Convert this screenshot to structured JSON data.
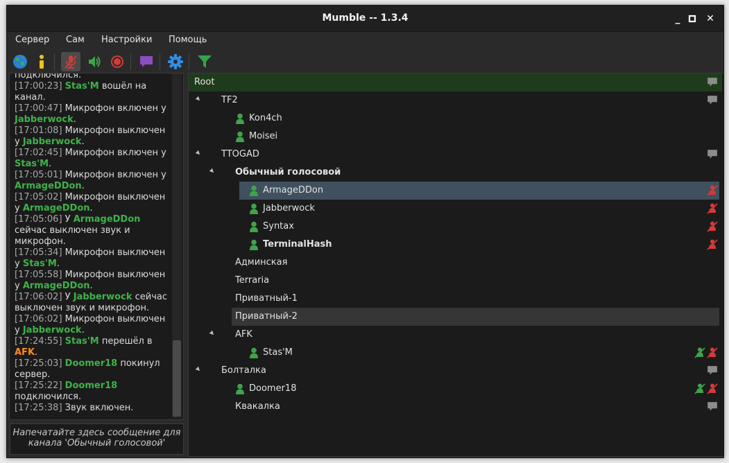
{
  "window": {
    "title": "Mumble -- 1.3.4"
  },
  "window_controls": {
    "minimize": "_",
    "maximize": "□",
    "close": "✕"
  },
  "menu": [
    "Сервер",
    "Сам",
    "Настройки",
    "Помощь"
  ],
  "toolbar": [
    {
      "id": "connect",
      "icon": "globe-icon"
    },
    {
      "id": "info",
      "icon": "info-icon"
    },
    {
      "id": "mute_self",
      "icon": "muted-mic-icon",
      "active": true
    },
    {
      "id": "deafen_self",
      "icon": "speaker-icon"
    },
    {
      "id": "record",
      "icon": "record-icon"
    },
    {
      "id": "text_message",
      "icon": "chat-bubble-icon"
    },
    {
      "id": "configure",
      "icon": "gear-icon"
    },
    {
      "id": "filter",
      "icon": "filter-icon"
    }
  ],
  "log": [
    [
      {
        "t": "text",
        "v": "подключился."
      }
    ],
    [
      {
        "t": "ts",
        "v": "[17:00:23]"
      },
      {
        "t": "text",
        "v": " "
      },
      {
        "t": "user",
        "v": "Stas'M"
      },
      {
        "t": "text",
        "v": " вошёл на канал."
      }
    ],
    [
      {
        "t": "ts",
        "v": "[17:00:47]"
      },
      {
        "t": "text",
        "v": " Микрофон включен у "
      },
      {
        "t": "user",
        "v": "Jabberwock"
      },
      {
        "t": "text",
        "v": "."
      }
    ],
    [
      {
        "t": "ts",
        "v": "[17:01:08]"
      },
      {
        "t": "text",
        "v": " Микрофон выключен у "
      },
      {
        "t": "user",
        "v": "Jabberwock"
      },
      {
        "t": "text",
        "v": "."
      }
    ],
    [
      {
        "t": "ts",
        "v": "[17:02:45]"
      },
      {
        "t": "text",
        "v": " Микрофон включен у "
      },
      {
        "t": "user",
        "v": "Stas'M"
      },
      {
        "t": "text",
        "v": "."
      }
    ],
    [
      {
        "t": "ts",
        "v": "[17:05:01]"
      },
      {
        "t": "text",
        "v": " Микрофон включен у "
      },
      {
        "t": "user",
        "v": "ArmageDDon"
      },
      {
        "t": "text",
        "v": "."
      }
    ],
    [
      {
        "t": "ts",
        "v": "[17:05:02]"
      },
      {
        "t": "text",
        "v": " Микрофон выключен у "
      },
      {
        "t": "user",
        "v": "ArmageDDon"
      },
      {
        "t": "text",
        "v": "."
      }
    ],
    [
      {
        "t": "ts",
        "v": "[17:05:06]"
      },
      {
        "t": "text",
        "v": " У "
      },
      {
        "t": "user",
        "v": "ArmageDDon"
      },
      {
        "t": "text",
        "v": " сейчас выключен звук и микрофон."
      }
    ],
    [
      {
        "t": "ts",
        "v": "[17:05:34]"
      },
      {
        "t": "text",
        "v": " Микрофон выключен у "
      },
      {
        "t": "user",
        "v": "Stas'M"
      },
      {
        "t": "text",
        "v": "."
      }
    ],
    [
      {
        "t": "ts",
        "v": "[17:05:58]"
      },
      {
        "t": "text",
        "v": " Микрофон выключен у "
      },
      {
        "t": "user",
        "v": "ArmageDDon"
      },
      {
        "t": "text",
        "v": "."
      }
    ],
    [
      {
        "t": "ts",
        "v": "[17:06:02]"
      },
      {
        "t": "text",
        "v": " У "
      },
      {
        "t": "user",
        "v": "Jabberwock"
      },
      {
        "t": "text",
        "v": " сейчас выключен звук и микрофон."
      }
    ],
    [
      {
        "t": "ts",
        "v": "[17:06:02]"
      },
      {
        "t": "text",
        "v": " Микрофон выключен у "
      },
      {
        "t": "user",
        "v": "Jabberwock"
      },
      {
        "t": "text",
        "v": "."
      }
    ],
    [
      {
        "t": "ts",
        "v": "[17:24:55]"
      },
      {
        "t": "text",
        "v": " "
      },
      {
        "t": "user",
        "v": "Stas'M"
      },
      {
        "t": "text",
        "v": " перешёл в "
      },
      {
        "t": "channel",
        "v": "AFK"
      },
      {
        "t": "text",
        "v": "."
      }
    ],
    [
      {
        "t": "ts",
        "v": "[17:25:03]"
      },
      {
        "t": "text",
        "v": " "
      },
      {
        "t": "user",
        "v": "Doomer18"
      },
      {
        "t": "text",
        "v": " покинул сервер."
      }
    ],
    [
      {
        "t": "ts",
        "v": "[17:25:22]"
      },
      {
        "t": "text",
        "v": " "
      },
      {
        "t": "user",
        "v": "Doomer18"
      },
      {
        "t": "text",
        "v": " подключился."
      }
    ],
    [
      {
        "t": "ts",
        "v": "[17:25:38]"
      },
      {
        "t": "text",
        "v": " Звук включен."
      }
    ]
  ],
  "chat_input": {
    "placeholder": "Напечатайте здесь сообщение для канала 'Обычный голосовой'"
  },
  "tree": [
    {
      "label": "Root",
      "type": "channel",
      "level": 0,
      "expander": false,
      "comment": true,
      "highlight": "root"
    },
    {
      "label": "TF2",
      "type": "channel",
      "level": 1,
      "expander": true,
      "comment": true
    },
    {
      "label": "Kon4ch",
      "type": "user",
      "level": 2
    },
    {
      "label": "Moisei",
      "type": "user",
      "level": 2
    },
    {
      "label": "TTOGAD",
      "type": "channel",
      "level": 1,
      "expander": true,
      "comment": true
    },
    {
      "label": "Обычный голосовой",
      "type": "channel",
      "level": 2,
      "expander": true,
      "bold": true
    },
    {
      "label": "ArmageDDon",
      "type": "user",
      "level": 3,
      "status": [
        "deafened"
      ],
      "highlight": "selected"
    },
    {
      "label": "Jabberwock",
      "type": "user",
      "level": 3,
      "status": [
        "deafened"
      ]
    },
    {
      "label": "Syntax",
      "type": "user",
      "level": 3,
      "status": [
        "deafened"
      ]
    },
    {
      "label": "TerminalHash",
      "type": "user",
      "level": 3,
      "bold": true,
      "status": [
        "deafened"
      ]
    },
    {
      "label": "Админская",
      "type": "channel",
      "level": 2
    },
    {
      "label": "Terraria",
      "type": "channel",
      "level": 2
    },
    {
      "label": "Приватный-1",
      "type": "channel",
      "level": 2
    },
    {
      "label": "Приватный-2",
      "type": "channel",
      "level": 2,
      "highlight": "hover"
    },
    {
      "label": "AFK",
      "type": "channel",
      "level": 2,
      "expander": true
    },
    {
      "label": "Stas'M",
      "type": "user",
      "level": 3,
      "status": [
        "muted",
        "deafened"
      ]
    },
    {
      "label": "Болталка",
      "type": "channel",
      "level": 1,
      "expander": true,
      "comment": true
    },
    {
      "label": "Doomer18",
      "type": "user",
      "level": 2,
      "status": [
        "muted",
        "deafened"
      ]
    },
    {
      "label": "Квакалка",
      "type": "channel",
      "level": 2,
      "comment": true
    }
  ],
  "colors": {
    "user_name": "#3fb24a",
    "channel_link": "#ff8c1a",
    "status_deafened": "#d43a3a",
    "status_muted": "#3fa34a",
    "selection": "#40505f",
    "root_highlight": "#1e3c1b"
  }
}
